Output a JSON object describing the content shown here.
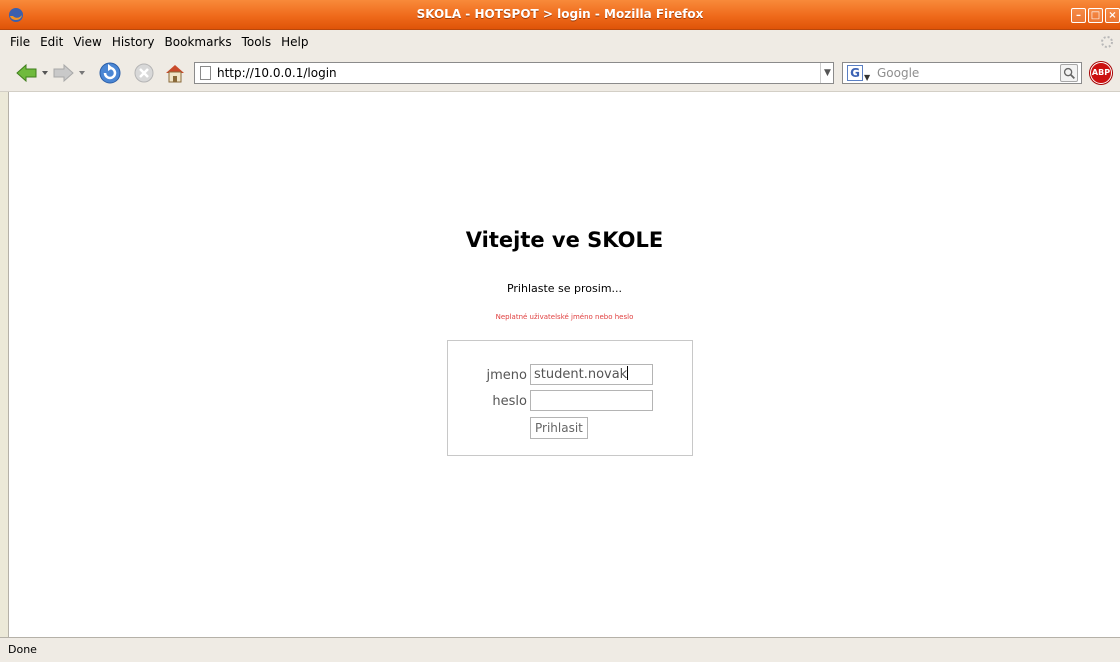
{
  "window": {
    "title": "SKOLA - HOTSPOT > login - Mozilla Firefox"
  },
  "menu": {
    "items": [
      {
        "label": "File"
      },
      {
        "label": "Edit"
      },
      {
        "label": "View"
      },
      {
        "label": "History"
      },
      {
        "label": "Bookmarks"
      },
      {
        "label": "Tools"
      },
      {
        "label": "Help"
      }
    ]
  },
  "navbar": {
    "url": "http://10.0.0.1/login",
    "search_placeholder": "Google",
    "adblock_label": "ABP"
  },
  "page": {
    "heading": "Vitejte ve SKOLE",
    "prompt": "Prihlaste se prosim...",
    "error": "Neplatné uživatelské jméno nebo heslo",
    "login": {
      "username_label": "jmeno",
      "username_value": "student.novak",
      "password_label": "heslo",
      "password_value": "",
      "submit_label": "Prihlasit"
    }
  },
  "status": {
    "text": "Done"
  }
}
